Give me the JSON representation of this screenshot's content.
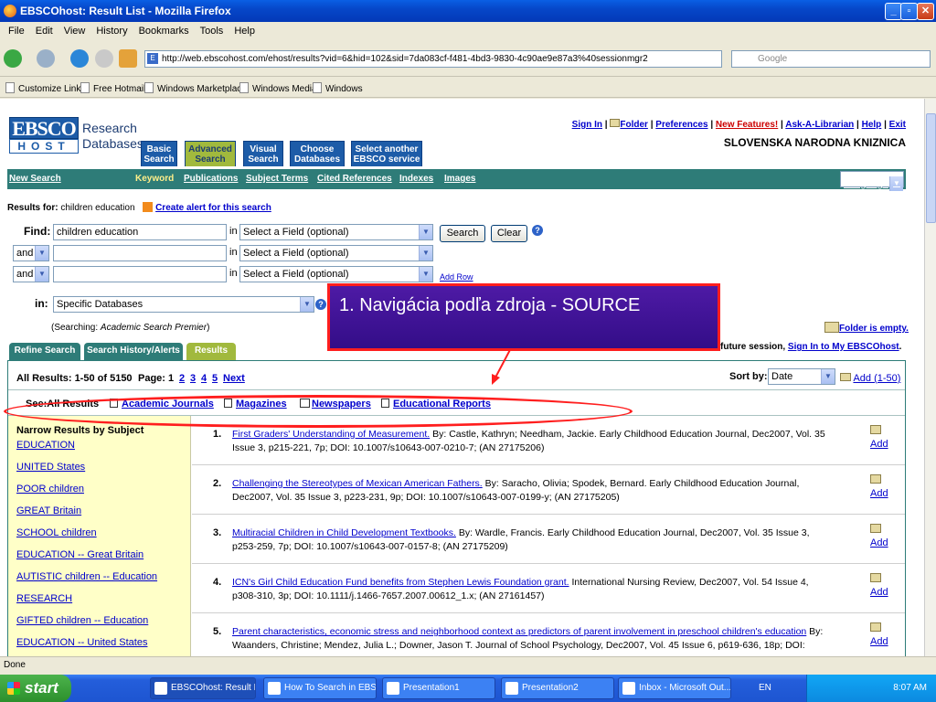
{
  "window": {
    "title": "EBSCOhost: Result List - Mozilla Firefox"
  },
  "menu": [
    "File",
    "Edit",
    "View",
    "History",
    "Bookmarks",
    "Tools",
    "Help"
  ],
  "address": {
    "url": "http://web.ebscohost.com/ehost/results?vid=6&hid=102&sid=7da083cf-f481-4bd3-9830-4c90ae9e87a3%40sessionmgr2",
    "search_placeholder": "Google"
  },
  "bookmarks": [
    "Customize Links",
    "Free Hotmail",
    "Windows Marketplace",
    "Windows Media",
    "Windows"
  ],
  "header": {
    "logo_top": "EBSCO",
    "logo_bottom": "HOST",
    "research": "Research",
    "databases": "Databases",
    "tabs": [
      {
        "l1": "Basic",
        "l2": "Search"
      },
      {
        "l1": "Advanced",
        "l2": "Search"
      },
      {
        "l1": "Visual",
        "l2": "Search"
      },
      {
        "l1": "Choose",
        "l2": "Databases"
      },
      {
        "l1": "Select another",
        "l2": "EBSCO service"
      }
    ],
    "links": [
      "Sign In",
      "Folder",
      "Preferences",
      "New Features!",
      "Ask-A-Librarian",
      "Help",
      "Exit"
    ],
    "library": "SLOVENSKA NARODNA KNIZNICA"
  },
  "nav": {
    "new_search": "New Search",
    "keyword": "Keyword",
    "items": [
      "Publications",
      "Subject Terms",
      "Cited References",
      "Indexes",
      "Images"
    ],
    "language": "Language"
  },
  "search": {
    "results_for_label": "Results for:",
    "results_for_value": "children education",
    "create_alert": "Create alert for this search",
    "find_label": "Find:",
    "find_value": "children education",
    "in": "in",
    "field_placeholder": "Select a Field (optional)",
    "and": "and",
    "search_btn": "Search",
    "clear_btn": "Clear",
    "add_row": "Add Row",
    "in_label": "in:",
    "db_select": "Specific Databases",
    "searching_prefix": "(Searching:",
    "searching_db": "Academic Search Premier",
    "searching_suffix": ")",
    "folder_empty": "Folder is empty.",
    "future_session": "future session,",
    "sign_in_my": "Sign In to My EBSCOhost",
    "period": "."
  },
  "subtabs": [
    "Refine Search",
    "Search History/Alerts",
    "Results"
  ],
  "results": {
    "all_results": "All Results: 1-50 of 5150",
    "page_label": "Page: 1",
    "pages": [
      "2",
      "3",
      "4",
      "5"
    ],
    "next": "Next",
    "sort_label": "Sort by:",
    "sort_value": "Date",
    "add_range": "Add (1-50)",
    "see_label": "See:",
    "see_all": "All Results",
    "see_types": [
      "Academic Journals",
      "Magazines",
      "Newspapers",
      "Educational Reports"
    ]
  },
  "narrow": {
    "heading": "Narrow Results by Subject",
    "subjects": [
      "EDUCATION",
      "UNITED States",
      "POOR children",
      "GREAT Britain",
      "SCHOOL children",
      "EDUCATION -- Great Britain",
      "AUTISTIC children -- Education",
      "RESEARCH",
      "GIFTED children -- Education",
      "EDUCATION -- United States"
    ]
  },
  "records": [
    {
      "num": "1.",
      "title": "First Graders' Understanding of Measurement.",
      "rest": " By: Castle, Kathryn; Needham, Jackie. Early Childhood Education Journal, Dec2007, Vol. 35 Issue 3, p215-221, 7p; DOI: 10.1007/s10643-007-0210-7; (AN 27175206)",
      "add": "Add"
    },
    {
      "num": "2.",
      "title": "Challenging the Stereotypes of Mexican American Fathers.",
      "rest": " By: Saracho, Olivia; Spodek, Bernard. Early Childhood Education Journal, Dec2007, Vol. 35 Issue 3, p223-231, 9p; DOI: 10.1007/s10643-007-0199-y; (AN 27175205)",
      "add": "Add"
    },
    {
      "num": "3.",
      "title": "Multiracial Children in Child Development Textbooks.",
      "rest": " By: Wardle, Francis. Early Childhood Education Journal, Dec2007, Vol. 35 Issue 3, p253-259, 7p; DOI: 10.1007/s10643-007-0157-8; (AN 27175209)",
      "add": "Add"
    },
    {
      "num": "4.",
      "title": "ICN's Girl Child Education Fund benefits from Stephen Lewis Foundation grant.",
      "rest": " International Nursing Review, Dec2007, Vol. 54 Issue 4, p308-310, 3p; DOI: 10.1111/j.1466-7657.2007.00612_1.x; (AN 27161457)",
      "add": "Add"
    },
    {
      "num": "5.",
      "title": "Parent characteristics, economic stress and neighborhood context as predictors of parent involvement in preschool children's education",
      "rest": " By: Waanders, Christine; Mendez, Julia L.; Downer, Jason T. Journal of School Psychology, Dec2007, Vol. 45 Issue 6, p619-636, 18p; DOI:",
      "add": "Add"
    }
  ],
  "callout": {
    "text": "1. Navigácia podľa zdroja - SOURCE"
  },
  "status": "Done",
  "taskbar": {
    "start": "start",
    "tasks": [
      "EBSCOhost: Result Li...",
      "How To Search in EBS...",
      "Presentation1",
      "Presentation2",
      "Inbox - Microsoft Out..."
    ],
    "lang": "EN",
    "clock": "8:07 AM"
  },
  "colors": {
    "accent_green": "#2e7c78",
    "olive_tab": "#a1b93d",
    "ebsco_blue": "#1d5ca8",
    "annotation_red": "#ff1e1e",
    "callout_purple": "#4e1aa5"
  }
}
